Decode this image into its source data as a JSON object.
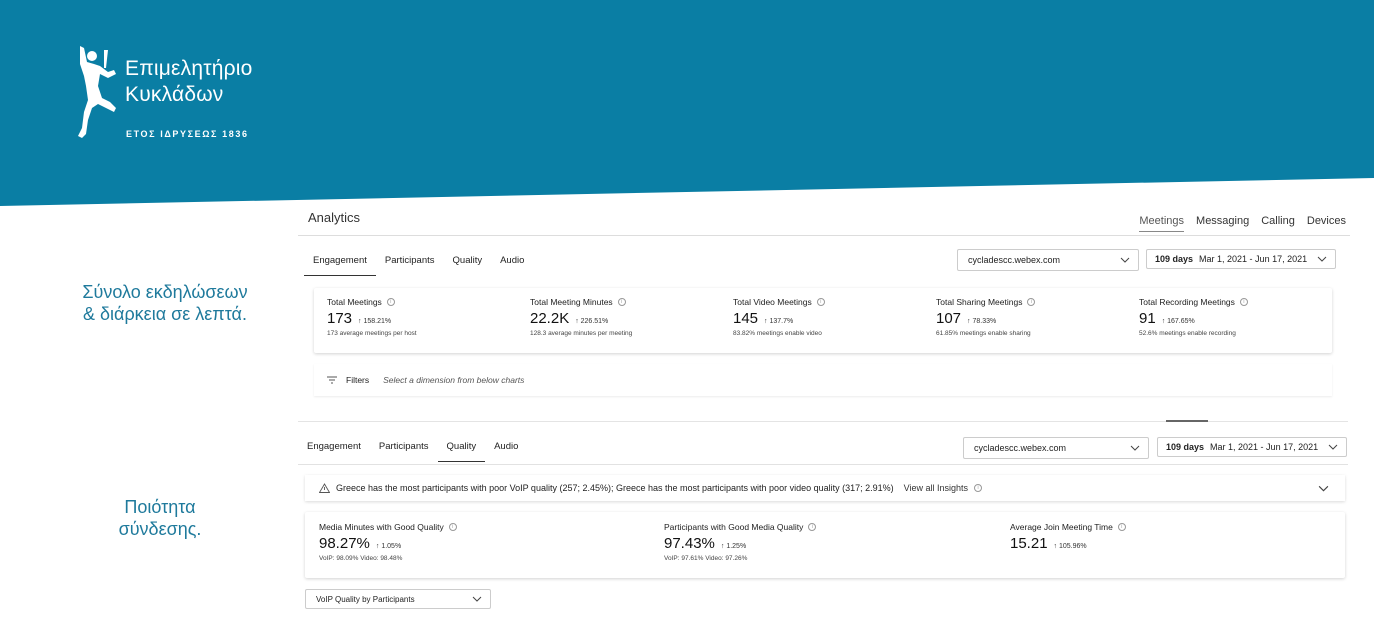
{
  "brand": {
    "title_line1": "Επιμελητήριο",
    "title_line2": "Κυκλάδων",
    "subtitle": "ΕΤΟΣ ΙΔΡΥΣΕΩΣ 1836",
    "banner_color": "#0a7ea4"
  },
  "captions": {
    "caption1_line1": "Σύνολο εκδηλώσεων",
    "caption1_line2": "& διάρκεια σε λεπτά.",
    "caption2_line1": "Ποιότητα",
    "caption2_line2": "σύνδεσης."
  },
  "panel1": {
    "title": "Analytics",
    "top_nav": [
      "Meetings",
      "Messaging",
      "Calling",
      "Devices"
    ],
    "active_top_nav": "Meetings",
    "subtabs": [
      "Engagement",
      "Participants",
      "Quality",
      "Audio"
    ],
    "active_subtab": "Engagement",
    "site_select": "cycladescc.webex.com",
    "date_days": "109 days",
    "date_range": "Mar 1, 2021 - Jun 17, 2021",
    "metrics": [
      {
        "label": "Total Meetings",
        "value": "173",
        "change": "↑ 158.21%",
        "note": "173 average meetings per host"
      },
      {
        "label": "Total Meeting Minutes",
        "value": "22.2K",
        "change": "↑ 226.51%",
        "note": "128.3 average minutes per meeting"
      },
      {
        "label": "Total Video Meetings",
        "value": "145",
        "change": "↑ 137.7%",
        "note": "83.82% meetings enable video"
      },
      {
        "label": "Total Sharing Meetings",
        "value": "107",
        "change": "↑ 78.33%",
        "note": "61.85% meetings enable sharing"
      },
      {
        "label": "Total Recording Meetings",
        "value": "91",
        "change": "↑ 167.65%",
        "note": "52.6% meetings enable recording"
      }
    ],
    "filters_label": "Filters",
    "filters_hint": "Select a dimension from below charts"
  },
  "panel2": {
    "subtabs": [
      "Engagement",
      "Participants",
      "Quality",
      "Audio"
    ],
    "active_subtab": "Quality",
    "site_select": "cycladescc.webex.com",
    "date_days": "109 days",
    "date_range": "Mar 1, 2021 - Jun 17, 2021",
    "insight_text": "Greece has the most participants with poor VoIP quality (257; 2.45%); Greece has the most participants with poor video quality (317; 2.91%)",
    "insight_link": "View all Insights",
    "metrics": [
      {
        "label": "Media Minutes with Good Quality",
        "value": "98.27%",
        "change": "↑ 1.05%",
        "note": "VoIP: 98.09% Video: 98.48%"
      },
      {
        "label": "Participants with Good Media Quality",
        "value": "97.43%",
        "change": "↑ 1.25%",
        "note": "VoIP: 97.61% Video: 97.26%"
      },
      {
        "label": "Average Join Meeting Time",
        "value": "15.21",
        "change": "↑ 105.96%",
        "note": ""
      }
    ],
    "chart_select": "VoIP Quality by Participants"
  }
}
